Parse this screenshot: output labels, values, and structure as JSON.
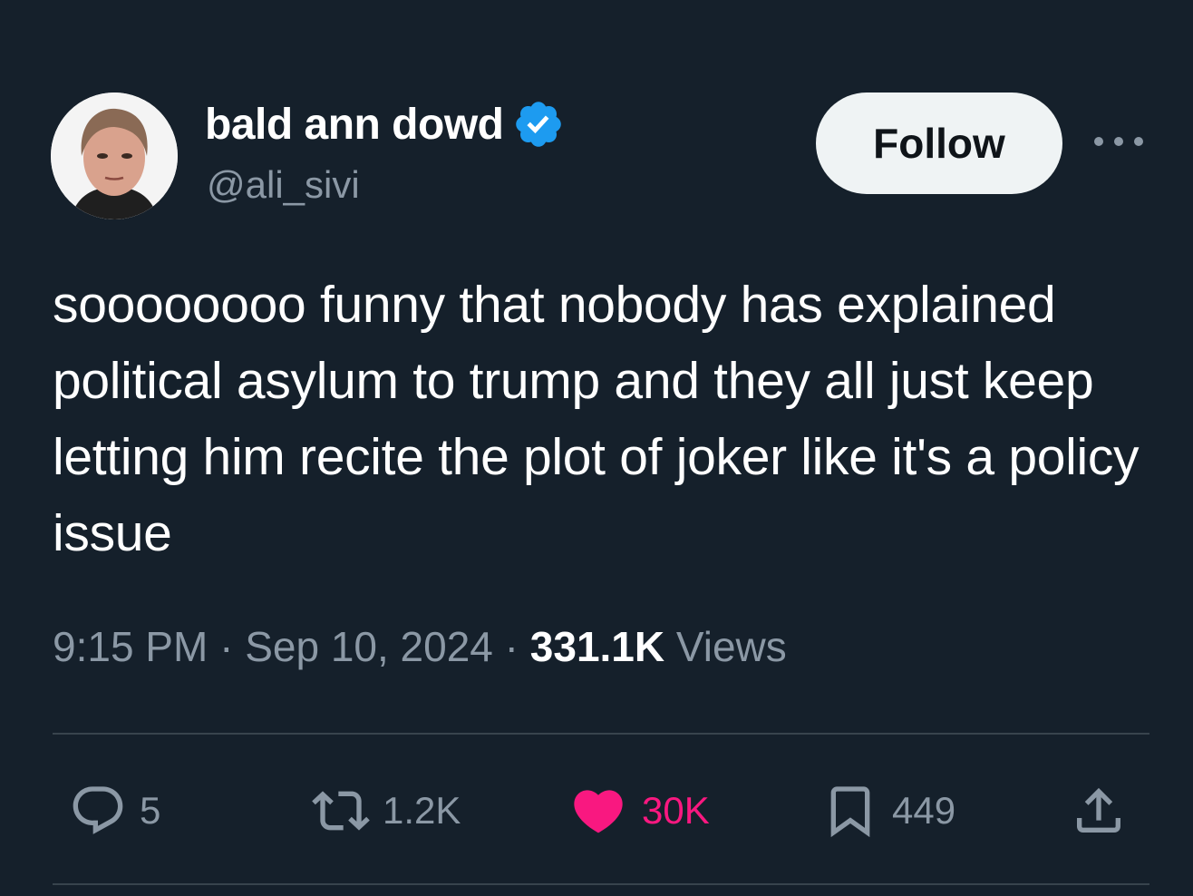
{
  "user": {
    "display_name": "bald ann dowd",
    "handle": "@ali_sivi",
    "verified": true,
    "avatar_icon": "profile-photo"
  },
  "follow_button": {
    "label": "Follow"
  },
  "more_icon": "ellipsis-icon",
  "tweet": {
    "text": "soooooooo funny that nobody has explained political asylum to trump and they all just keep letting him recite the plot of joker like it's a policy issue"
  },
  "meta": {
    "time": "9:15 PM",
    "separator": "·",
    "date": "Sep 10, 2024",
    "views_count": "331.1K",
    "views_label": "Views"
  },
  "actions": {
    "replies": "5",
    "retweets": "1.2K",
    "likes": "30K",
    "bookmarks": "449"
  },
  "colors": {
    "background": "#15202b",
    "secondary_text": "#8b98a5",
    "verified_badge": "#1d9bf0",
    "like": "#f91880",
    "follow_bg": "#eff3f4",
    "divider": "#38444d"
  }
}
